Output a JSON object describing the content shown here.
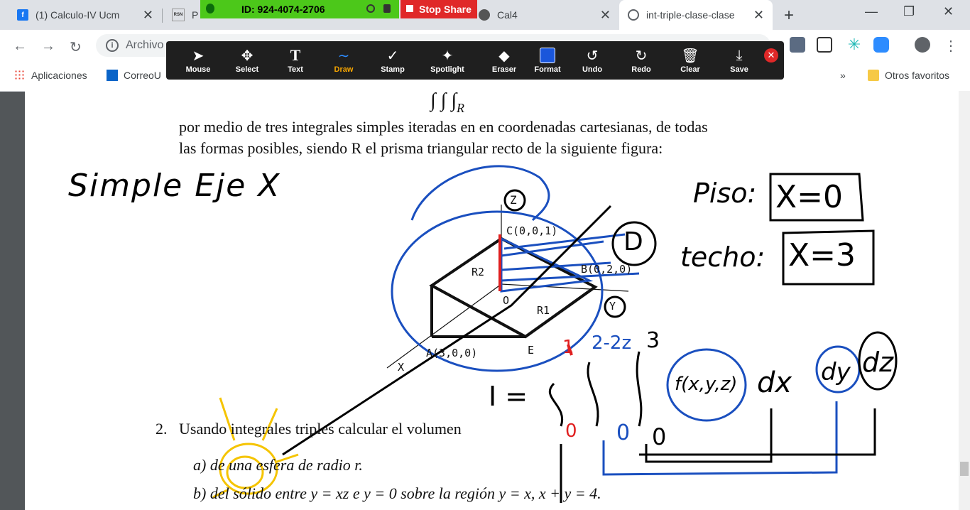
{
  "browser": {
    "tabs": [
      {
        "title": "(1) Calculo-IV Ucm",
        "icon": "facebook-icon"
      },
      {
        "title": "P",
        "icon": "resuna-icon"
      },
      {
        "title": "Cal4",
        "icon": "github-icon"
      },
      {
        "title": "int-triple-clase-clase",
        "icon": "globe-icon"
      }
    ],
    "address_prefix": "Archivo",
    "bookmarks": [
      {
        "label": "Aplicaciones",
        "icon": "apps-grid-icon"
      },
      {
        "label": "CorreoU",
        "icon": "outlook-icon"
      },
      {
        "label": "Otros favoritos",
        "icon": "folder-icon"
      }
    ],
    "overflow_label": "»"
  },
  "zoom": {
    "meeting_id": "ID: 924-4074-2706",
    "stop_share": "Stop Share",
    "tools": [
      {
        "label": "Mouse",
        "icon": "cursor-icon"
      },
      {
        "label": "Select",
        "icon": "move-icon"
      },
      {
        "label": "Text",
        "icon": "text-icon"
      },
      {
        "label": "Draw",
        "icon": "draw-icon",
        "selected": true
      },
      {
        "label": "Stamp",
        "icon": "check-icon"
      },
      {
        "label": "Spotlight",
        "icon": "spotlight-icon"
      },
      {
        "label": "Eraser",
        "icon": "eraser-icon"
      },
      {
        "label": "Format",
        "icon": "format-icon"
      },
      {
        "label": "Undo",
        "icon": "undo-icon"
      },
      {
        "label": "Redo",
        "icon": "redo-icon"
      },
      {
        "label": "Clear",
        "icon": "trash-icon"
      },
      {
        "label": "Save",
        "icon": "save-icon"
      }
    ],
    "accent": "#f7a600",
    "format_color": "#1a56db"
  },
  "document": {
    "line1": "por medio de tres integrales simples iteradas en en coordenadas cartesianas, de todas",
    "line2": "las formas posibles, siendo R el prisma triangular recto de la siguiente figura:",
    "item2_num": "2.",
    "item2_text": "Usando integrales triples calcular el volumen",
    "item2a": "a)  de una esfera de radio r.",
    "item2b": "b)  del sólido entre y = xz e y = 0 sobre la región y = x, x + y = 4.",
    "figure_labels": {
      "z": "Z",
      "c": "C(0,0,1)",
      "b": "B(0,2,0)",
      "r2": "R2",
      "r1": "R1",
      "o": "O",
      "a": "A(3,0,0)",
      "e": "E",
      "y": "Y",
      "x": "X"
    }
  },
  "annotations": {
    "left_note": "Simple Eje X",
    "piso": "Piso:",
    "piso_eq": "X=0",
    "techo": "techo:",
    "techo_eq": "X=3",
    "d_label": "D",
    "z_label": "Z",
    "y_label": "Y",
    "integral_I": "I =",
    "upper_1": "1",
    "upper_2": "2-2z",
    "upper_3": "3",
    "lower_1": "0",
    "lower_2": "0",
    "lower_3": "0",
    "integrand": "f(x,y,z)",
    "dx": "dx",
    "dy": "dy",
    "dz": "dz"
  }
}
